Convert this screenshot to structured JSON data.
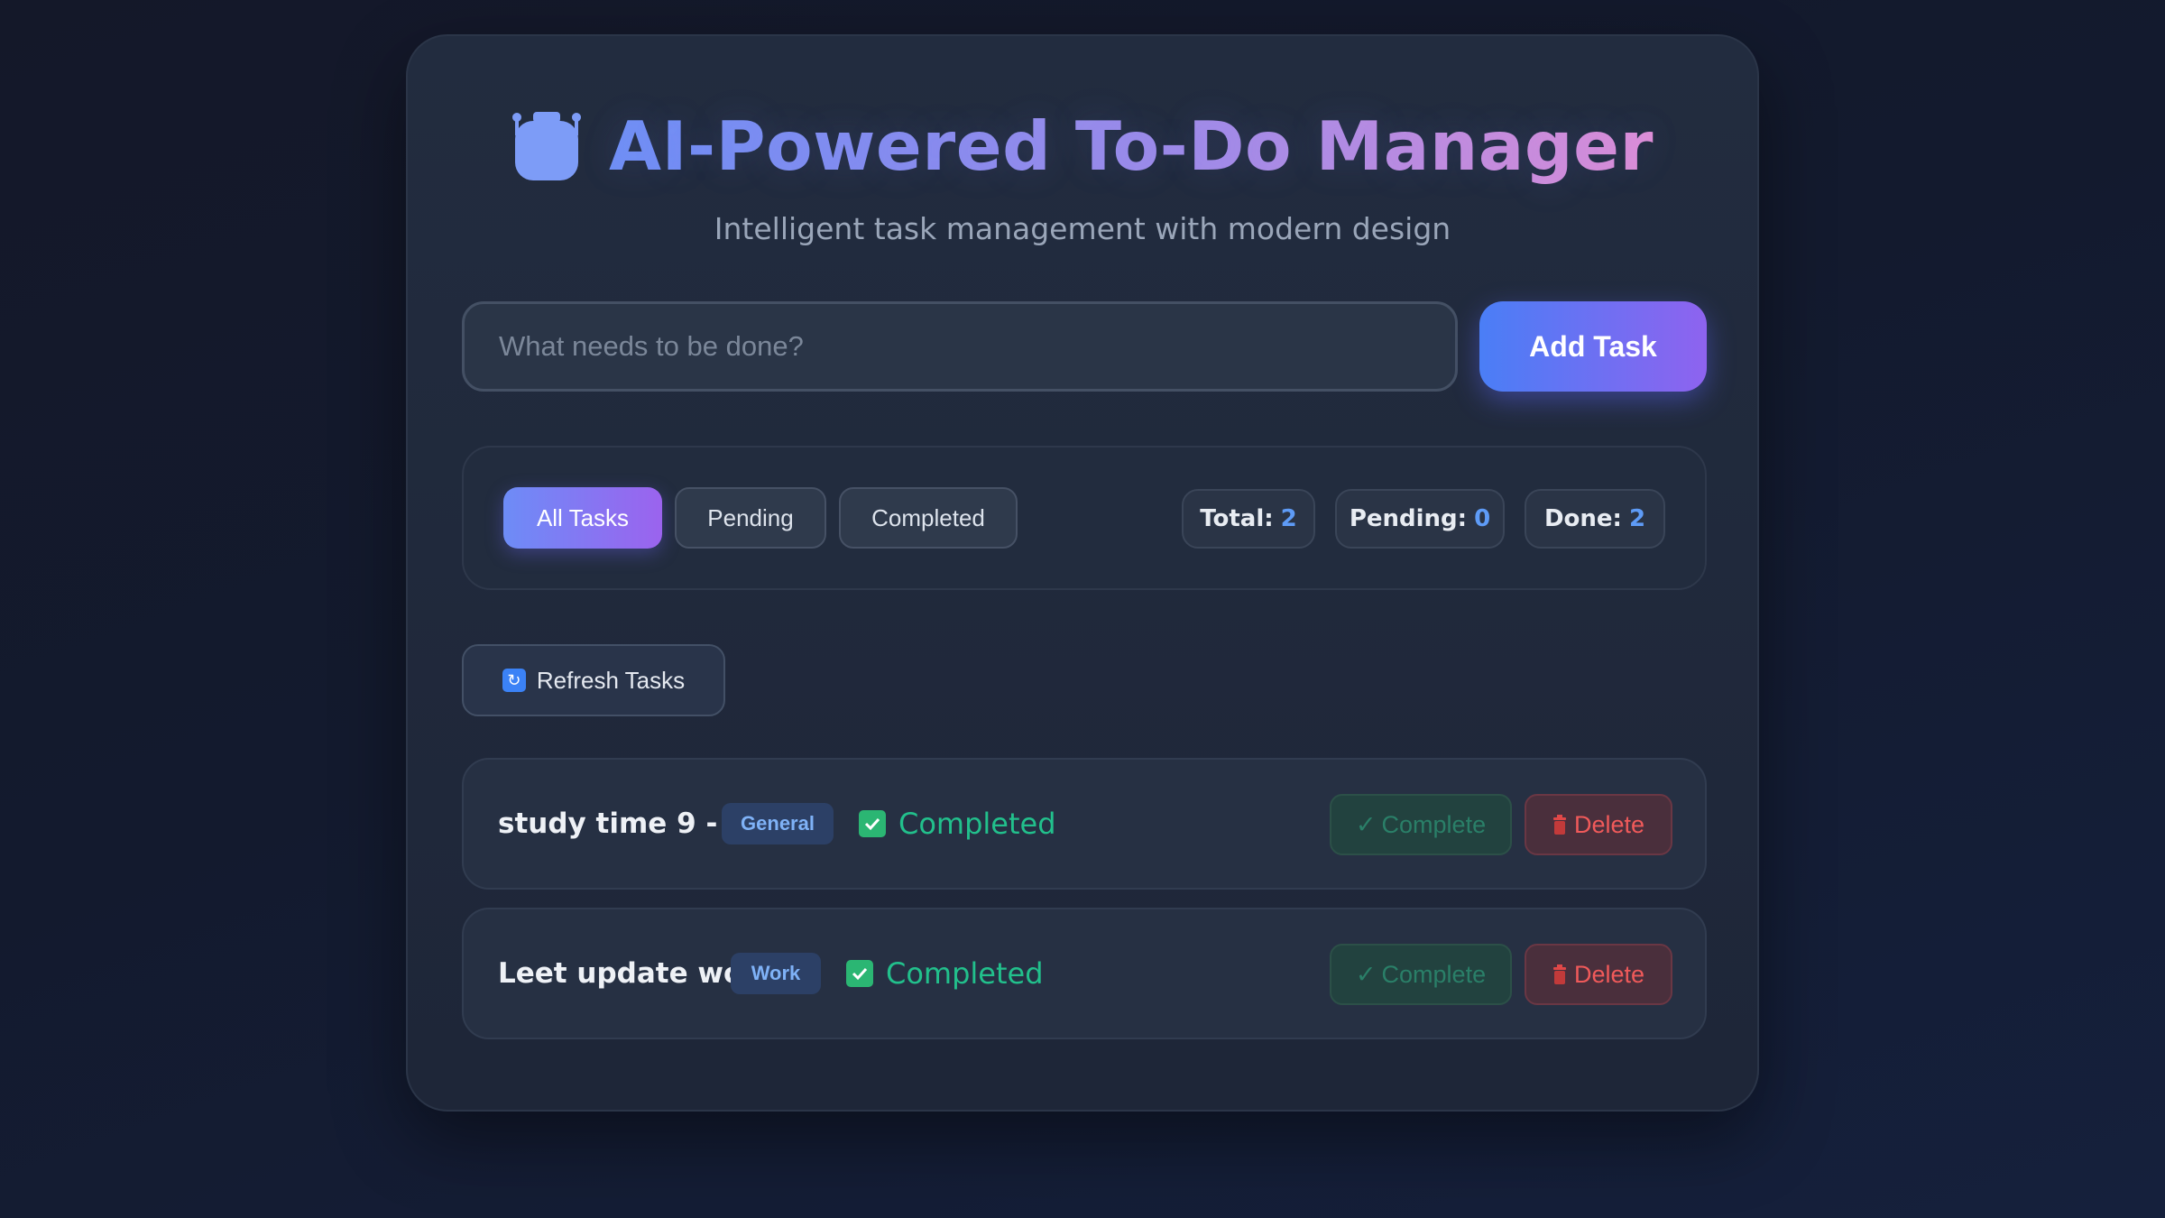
{
  "header": {
    "icon": "robot-icon",
    "title": "AI-Powered To-Do Manager",
    "subtitle": "Intelligent task management with modern design"
  },
  "new_task": {
    "placeholder": "What needs to be done?",
    "value": "",
    "add_label": "Add Task"
  },
  "filters": [
    {
      "label": "All Tasks",
      "active": true
    },
    {
      "label": "Pending",
      "active": false
    },
    {
      "label": "Completed",
      "active": false
    }
  ],
  "stats": {
    "total_label": "Total:",
    "total": "2",
    "pending_label": "Pending:",
    "pending": "0",
    "done_label": "Done:",
    "done": "2"
  },
  "refresh": {
    "icon": "refresh-icon",
    "label": "Refresh Tasks"
  },
  "tasks": [
    {
      "title": "study time 9 - 10",
      "tag": "General",
      "status": "Completed",
      "complete_label": "Complete",
      "delete_label": "Delete"
    },
    {
      "title": "Leet update work",
      "tag": "Work",
      "status": "Completed",
      "complete_label": "Complete",
      "delete_label": "Delete"
    }
  ],
  "colors": {
    "accent_blue": "#4a7ef6",
    "accent_purple": "#8e63ef",
    "success": "#22c08c",
    "danger": "#f05a5a"
  }
}
